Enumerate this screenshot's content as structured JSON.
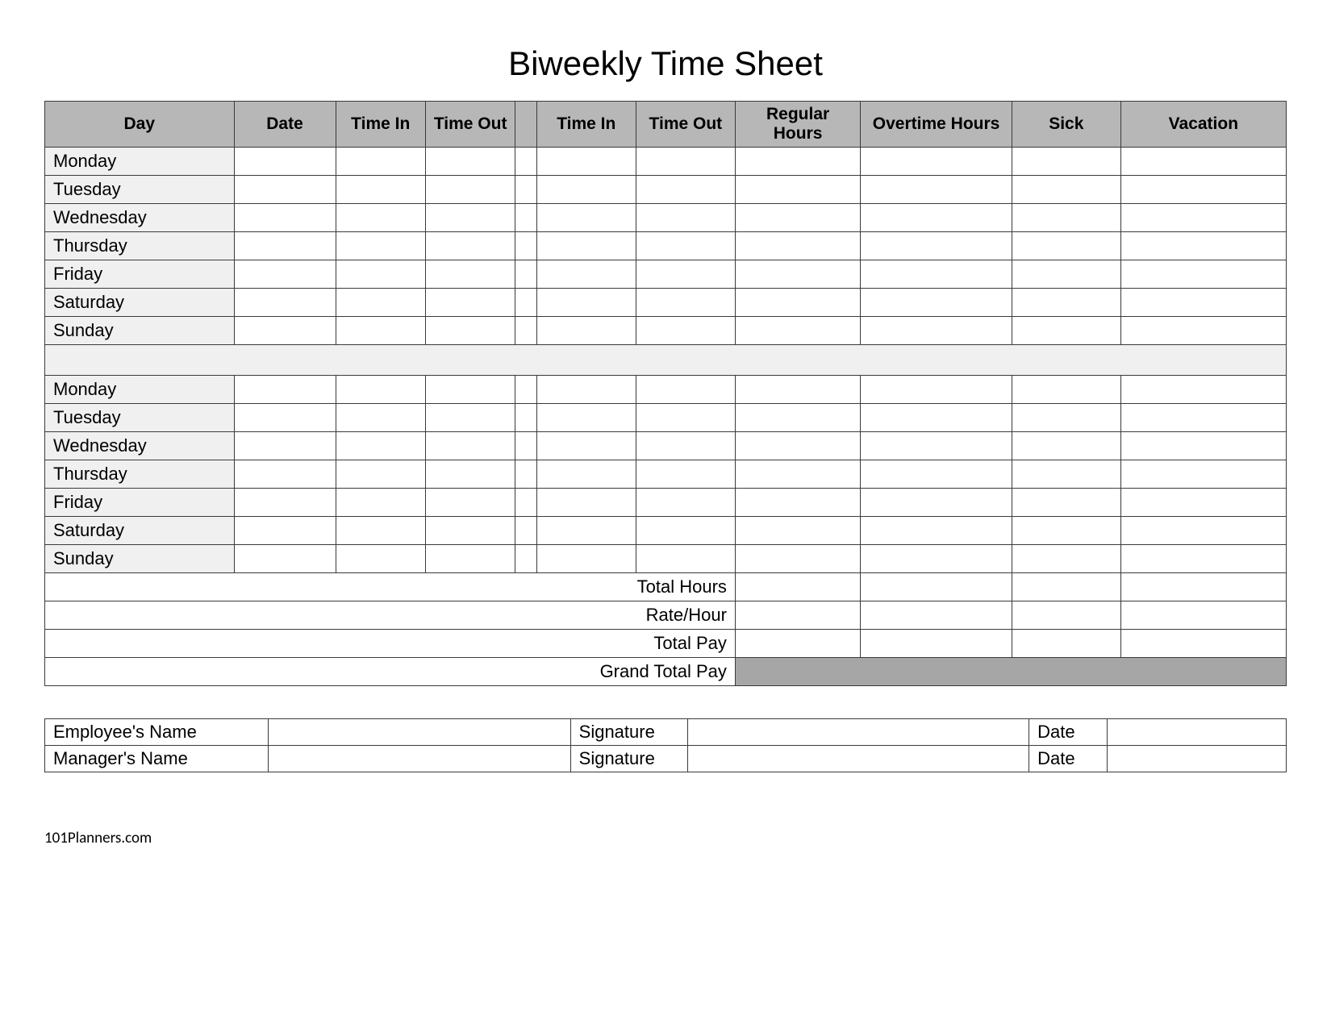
{
  "title": "Biweekly Time Sheet",
  "columns": [
    "Day",
    "Date",
    "Time In",
    "Time Out",
    "",
    "Time In",
    "Time Out",
    "Regular Hours",
    "Overtime Hours",
    "Sick",
    "Vacation"
  ],
  "week1": [
    {
      "day": "Monday",
      "date": "",
      "tin1": "",
      "tout1": "",
      "tin2": "",
      "tout2": "",
      "reg": "",
      "ot": "",
      "sick": "",
      "vac": ""
    },
    {
      "day": "Tuesday",
      "date": "",
      "tin1": "",
      "tout1": "",
      "tin2": "",
      "tout2": "",
      "reg": "",
      "ot": "",
      "sick": "",
      "vac": ""
    },
    {
      "day": "Wednesday",
      "date": "",
      "tin1": "",
      "tout1": "",
      "tin2": "",
      "tout2": "",
      "reg": "",
      "ot": "",
      "sick": "",
      "vac": ""
    },
    {
      "day": "Thursday",
      "date": "",
      "tin1": "",
      "tout1": "",
      "tin2": "",
      "tout2": "",
      "reg": "",
      "ot": "",
      "sick": "",
      "vac": ""
    },
    {
      "day": "Friday",
      "date": "",
      "tin1": "",
      "tout1": "",
      "tin2": "",
      "tout2": "",
      "reg": "",
      "ot": "",
      "sick": "",
      "vac": ""
    },
    {
      "day": "Saturday",
      "date": "",
      "tin1": "",
      "tout1": "",
      "tin2": "",
      "tout2": "",
      "reg": "",
      "ot": "",
      "sick": "",
      "vac": ""
    },
    {
      "day": "Sunday",
      "date": "",
      "tin1": "",
      "tout1": "",
      "tin2": "",
      "tout2": "",
      "reg": "",
      "ot": "",
      "sick": "",
      "vac": ""
    }
  ],
  "week2": [
    {
      "day": "Monday",
      "date": "",
      "tin1": "",
      "tout1": "",
      "tin2": "",
      "tout2": "",
      "reg": "",
      "ot": "",
      "sick": "",
      "vac": ""
    },
    {
      "day": "Tuesday",
      "date": "",
      "tin1": "",
      "tout1": "",
      "tin2": "",
      "tout2": "",
      "reg": "",
      "ot": "",
      "sick": "",
      "vac": ""
    },
    {
      "day": "Wednesday",
      "date": "",
      "tin1": "",
      "tout1": "",
      "tin2": "",
      "tout2": "",
      "reg": "",
      "ot": "",
      "sick": "",
      "vac": ""
    },
    {
      "day": "Thursday",
      "date": "",
      "tin1": "",
      "tout1": "",
      "tin2": "",
      "tout2": "",
      "reg": "",
      "ot": "",
      "sick": "",
      "vac": ""
    },
    {
      "day": "Friday",
      "date": "",
      "tin1": "",
      "tout1": "",
      "tin2": "",
      "tout2": "",
      "reg": "",
      "ot": "",
      "sick": "",
      "vac": ""
    },
    {
      "day": "Saturday",
      "date": "",
      "tin1": "",
      "tout1": "",
      "tin2": "",
      "tout2": "",
      "reg": "",
      "ot": "",
      "sick": "",
      "vac": ""
    },
    {
      "day": "Sunday",
      "date": "",
      "tin1": "",
      "tout1": "",
      "tin2": "",
      "tout2": "",
      "reg": "",
      "ot": "",
      "sick": "",
      "vac": ""
    }
  ],
  "summary_rows": [
    {
      "label": "Total Hours",
      "reg": "",
      "ot": "",
      "sick": "",
      "vac": ""
    },
    {
      "label": "Rate/Hour",
      "reg": "",
      "ot": "",
      "sick": "",
      "vac": ""
    },
    {
      "label": "Total Pay",
      "reg": "",
      "ot": "",
      "sick": "",
      "vac": ""
    }
  ],
  "grand_total": {
    "label": "Grand Total Pay",
    "value": ""
  },
  "sig": {
    "employee_name_label": "Employee's Name",
    "employee_name": "",
    "employee_sig_label": "Signature",
    "employee_sig": "",
    "employee_date_label": "Date",
    "employee_date": "",
    "manager_name_label": "Manager's Name",
    "manager_name": "",
    "manager_sig_label": "Signature",
    "manager_sig": "",
    "manager_date_label": "Date",
    "manager_date": ""
  },
  "footer": "101Planners.com"
}
